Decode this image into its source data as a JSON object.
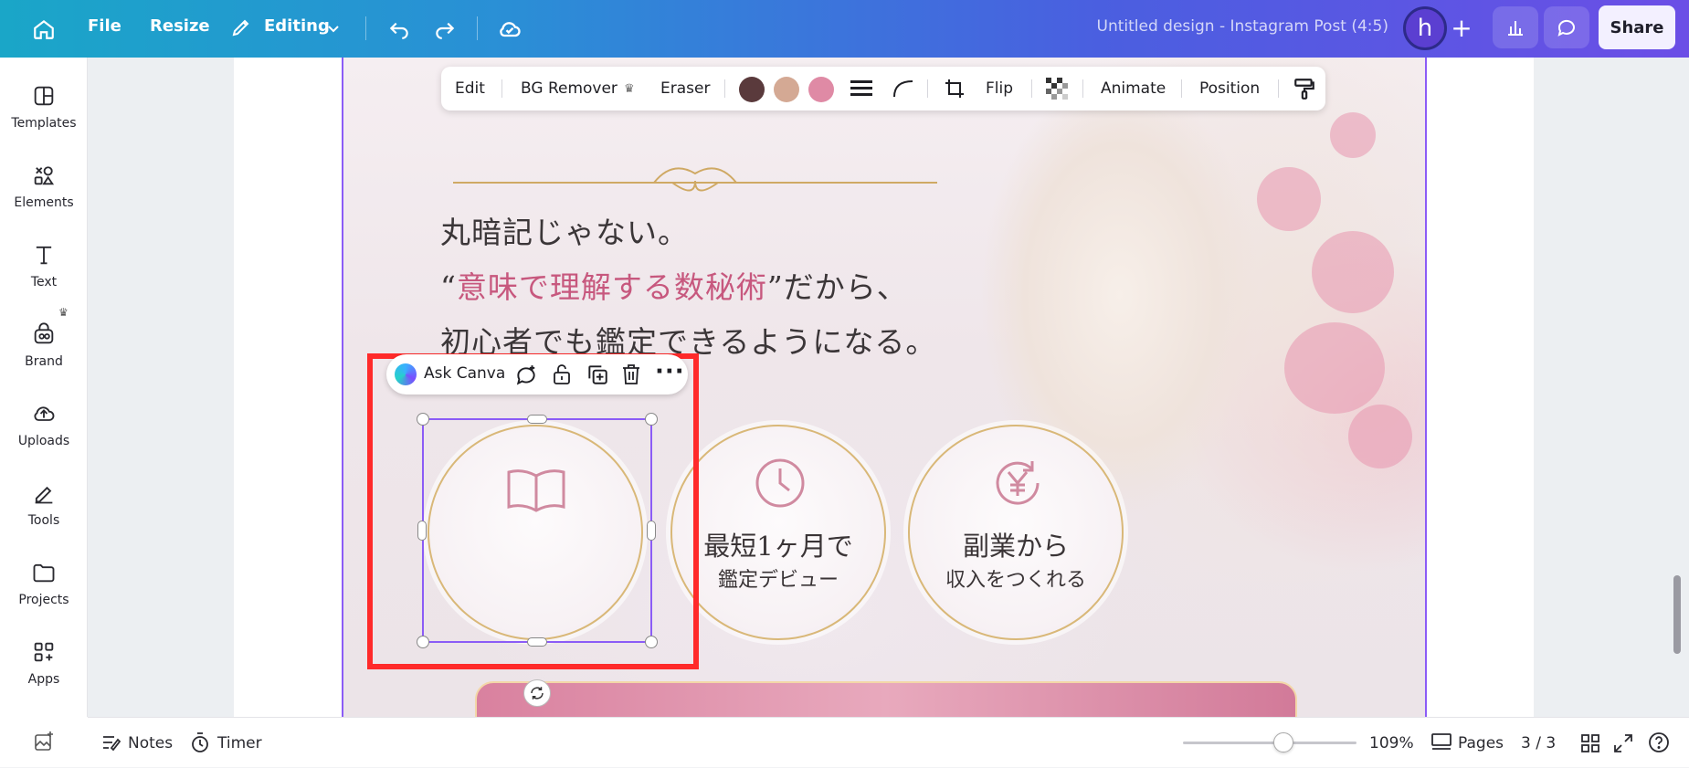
{
  "topbar": {
    "file_label": "File",
    "resize_label": "Resize",
    "editing_label": "Editing",
    "doc_title": "Untitled design - Instagram Post (4:5)",
    "avatar_letter": "h",
    "share_label": "Share"
  },
  "sidebar": {
    "items": [
      {
        "label": "Templates",
        "icon": "templates-icon"
      },
      {
        "label": "Elements",
        "icon": "elements-icon"
      },
      {
        "label": "Text",
        "icon": "text-icon"
      },
      {
        "label": "Brand",
        "icon": "brand-icon"
      },
      {
        "label": "Uploads",
        "icon": "uploads-icon"
      },
      {
        "label": "Tools",
        "icon": "tools-icon"
      },
      {
        "label": "Projects",
        "icon": "projects-icon"
      },
      {
        "label": "Apps",
        "icon": "apps-icon"
      }
    ]
  },
  "context_toolbar": {
    "edit": "Edit",
    "bg_remover": "BG Remover",
    "eraser": "Eraser",
    "colors": [
      "#5a3a3c",
      "#d4a994",
      "#df8aa5"
    ],
    "flip": "Flip",
    "animate": "Animate",
    "position": "Position"
  },
  "element_toolbar": {
    "ask_canva": "Ask Canva"
  },
  "design": {
    "line1": "丸暗記じゃない。",
    "line2_open": "“",
    "line2_pink": "意味で理解する数秘術",
    "line2_rest": "”だから、",
    "line3": "初心者でも鑑定できるようになる。",
    "circles": [
      {
        "line1": "",
        "line2": "",
        "icon": "open-book-icon"
      },
      {
        "line1": "最短1ヶ月で",
        "line2": "鑑定デビュー",
        "icon": "clock-icon"
      },
      {
        "line1": "副業から",
        "line2": "収入をつくれる",
        "icon": "yen-icon"
      }
    ]
  },
  "bottombar": {
    "notes": "Notes",
    "timer": "Timer",
    "zoom": "109%",
    "zoom_fraction": 0.59,
    "pages": "Pages",
    "page_count": "3 / 3"
  }
}
